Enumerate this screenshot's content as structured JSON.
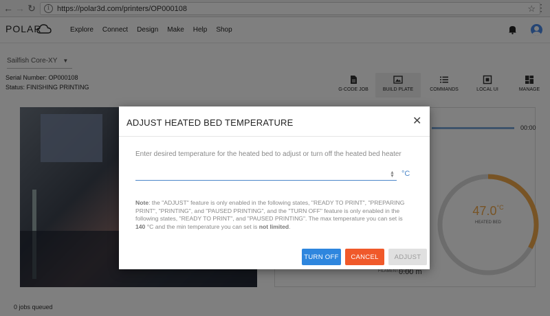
{
  "browser": {
    "url": "https://polar3d.com/printers/OP000108",
    "back": "←",
    "forward": "→",
    "reload": "↻",
    "info": "i",
    "star": "☆",
    "menu": "⋮"
  },
  "header": {
    "logo": "POLAR",
    "nav": [
      "Explore",
      "Connect",
      "Design",
      "Make",
      "Help",
      "Shop"
    ]
  },
  "page": {
    "printer_select": "Sailfish Core-XY",
    "serial": "Serial Number: OP000108",
    "status": "Status: FINISHING PRINTING",
    "tools": [
      {
        "label": "G-CODE JOB",
        "icon": "file-icon"
      },
      {
        "label": "BUILD PLATE",
        "icon": "image-icon"
      },
      {
        "label": "COMMANDS",
        "icon": "list-icon"
      },
      {
        "label": "LOCAL UI",
        "icon": "network-icon"
      },
      {
        "label": "MANAGE",
        "icon": "dashboard-icon"
      }
    ],
    "time": "00:00",
    "bed_temperature": "47.0",
    "bed_unit": "°C",
    "bed_label": "HEATED BED",
    "bed_gauge_level": 0.33,
    "filament_label": "FILAMENT USED",
    "filament_value": "0.00 m",
    "jobs_queued": "0 jobs queued"
  },
  "modal": {
    "title": "ADJUST HEATED BED TEMPERATURE",
    "close": "✕",
    "prompt": "Enter desired temperature for the heated bed to adjust or turn off the heated bed heater",
    "input_value": "",
    "unit": "°C",
    "note": {
      "label": "Note",
      "text1": ": the \"ADJUST\" feature is only enabled in the following states, \"READY TO PRINT\", \"PREPARING PRINT\", \"PRINTING\", and \"PAUSED PRINTING\", and the \"TURN OFF\" feature is only enabled in the following states, \"READY TO PRINT\", and \"PAUSED PRINTING\". The max temperature you can set is ",
      "max": "140",
      "text2": " °C and the min temperature you can set is ",
      "min": "not limited",
      "text3": "."
    },
    "buttons": {
      "turn_off": "TURN OFF",
      "cancel": "CANCEL",
      "adjust": "ADJUST"
    },
    "colors": {
      "turn_off": "#2e86de",
      "cancel": "#f0592a",
      "accent": "#4a86c8"
    }
  }
}
